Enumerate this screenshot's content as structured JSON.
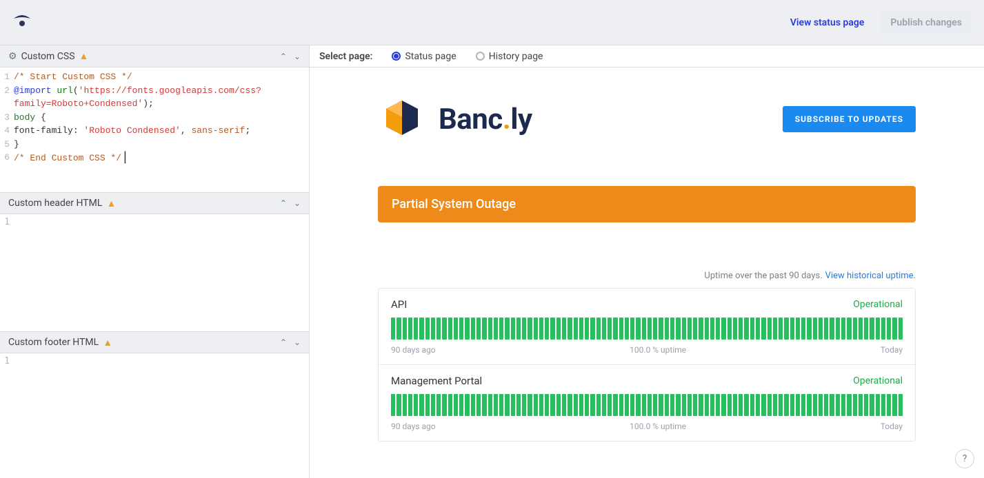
{
  "topbar": {
    "view_link": "View status page",
    "publish_label": "Publish changes"
  },
  "left": {
    "panels": {
      "css": {
        "title": "Custom CSS"
      },
      "header_html": {
        "title": "Custom header HTML"
      },
      "footer_html": {
        "title": "Custom footer HTML"
      }
    },
    "css_code": {
      "l1": "/* Start Custom CSS */",
      "l2_atrule": "@import",
      "l2_kw": "url",
      "l2_str": "'https://fonts.googleapis.com/css?family=Roboto+Condensed'",
      "l2_end": ";",
      "l3_sel": "body",
      "l3_brace": " {",
      "l4_prop": "font-family: ",
      "l4_str": "'Roboto Condensed'",
      "l4_comma": ", ",
      "l4_val": "sans-serif",
      "l4_semi": ";",
      "l5": "}",
      "l6": "/* End Custom CSS */"
    }
  },
  "right": {
    "select_label": "Select page:",
    "radio_status": "Status page",
    "radio_history": "History page"
  },
  "preview": {
    "brand": {
      "part1": "Banc",
      "sep": ".",
      "part2": "ly"
    },
    "subscribe": "SUBSCRIBE TO UPDATES",
    "banner": "Partial System Outage",
    "uptime_note": "Uptime over the past 90 days.",
    "uptime_link": "View historical uptime.",
    "services": [
      {
        "name": "API",
        "state": "Operational",
        "left": "90 days ago",
        "center": "100.0 % uptime",
        "right": "Today"
      },
      {
        "name": "Management Portal",
        "state": "Operational",
        "left": "90 days ago",
        "center": "100.0 % uptime",
        "right": "Today"
      }
    ]
  },
  "line_numbers": {
    "n1": "1",
    "n2": "2",
    "n3": "3",
    "n4": "4",
    "n5": "5",
    "n6": "6"
  }
}
